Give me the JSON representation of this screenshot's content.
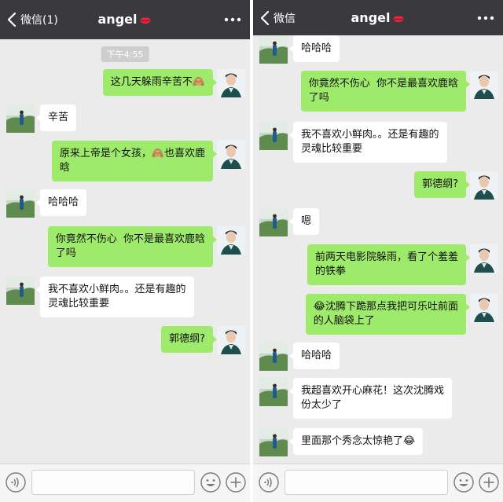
{
  "left": {
    "back_label": "微信(1)",
    "title": "angel",
    "timestamp": "下午4:55",
    "messages": [
      {
        "dir": "out",
        "text": "这几天躲雨辛苦不🙈"
      },
      {
        "dir": "in",
        "text": "辛苦"
      },
      {
        "dir": "out",
        "text": "原来上帝是个女孩，🙈也喜欢鹿\n晗"
      },
      {
        "dir": "in",
        "text": "哈哈哈"
      },
      {
        "dir": "out",
        "text": "你竟然不伤心  你不是最喜欢鹿晗\n了吗"
      },
      {
        "dir": "in",
        "text": "我不喜欢小鲜肉。。还是有趣的\n灵魂比较重要"
      },
      {
        "dir": "out",
        "text": "郭德纲?"
      }
    ]
  },
  "right": {
    "back_label": "微信",
    "title": "angel",
    "messages": [
      {
        "dir": "in",
        "text": "哈哈哈"
      },
      {
        "dir": "out",
        "text": "你竟然不伤心  你不是最喜欢鹿晗\n了吗"
      },
      {
        "dir": "in",
        "text": "我不喜欢小鲜肉。。还是有趣的\n灵魂比较重要"
      },
      {
        "dir": "out",
        "text": "郭德纲?"
      },
      {
        "dir": "in",
        "text": "嗯"
      },
      {
        "dir": "out",
        "text": "前两天电影院躲雨，看了个羞羞\n的铁拳"
      },
      {
        "dir": "out",
        "text": "😂沈腾下跪那点我把可乐吐前面\n的人脑袋上了"
      },
      {
        "dir": "in",
        "text": "哈哈哈"
      },
      {
        "dir": "in",
        "text": "我超喜欢开心麻花！这次沈腾戏\n份太少了"
      },
      {
        "dir": "in",
        "text": "里面那个秀念太惊艳了😂"
      }
    ]
  },
  "icons": {
    "back": "chevron-left-icon",
    "title_emoji": "lips-icon",
    "more": "ellipsis-icon",
    "voice": "voice-icon",
    "emoji": "smiley-icon",
    "plus": "plus-icon"
  },
  "colors": {
    "navbar": "#39393e",
    "chat_bg": "#ebebeb",
    "bubble_out": "#9eea6a",
    "bubble_in": "#ffffff"
  }
}
